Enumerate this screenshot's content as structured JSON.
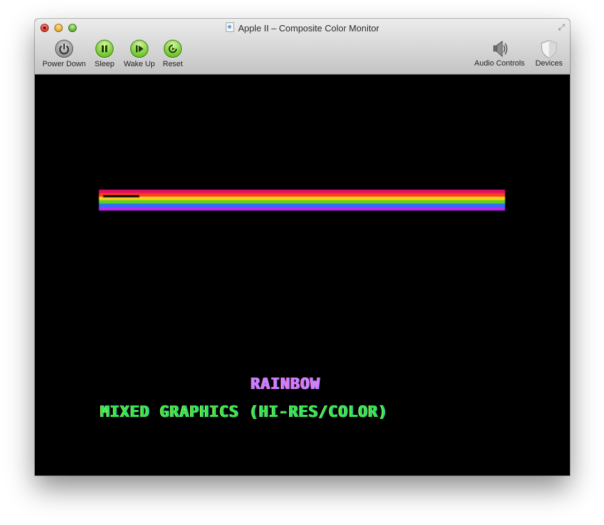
{
  "window": {
    "title": "Apple II – Composite Color Monitor"
  },
  "toolbar": {
    "left": [
      {
        "id": "power-down",
        "label": "Power Down",
        "icon": "power-icon"
      },
      {
        "id": "sleep",
        "label": "Sleep",
        "icon": "pause-icon"
      },
      {
        "id": "wake-up",
        "label": "Wake Up",
        "icon": "play-icon"
      },
      {
        "id": "reset",
        "label": "Reset",
        "icon": "reset-icon"
      }
    ],
    "right": [
      {
        "id": "audio-controls",
        "label": "Audio Controls",
        "icon": "speaker-icon"
      },
      {
        "id": "devices",
        "label": "Devices",
        "icon": "shield-icon"
      }
    ]
  },
  "screen": {
    "rainbow_colors": [
      "#e0106a",
      "#ff3b1a",
      "#f6d21d",
      "#5fd21f",
      "#2c6cff",
      "#b52cf0"
    ],
    "line1": "RAINBOW",
    "line2": "MIXED GRAPHICS (HI-RES/COLOR)"
  }
}
